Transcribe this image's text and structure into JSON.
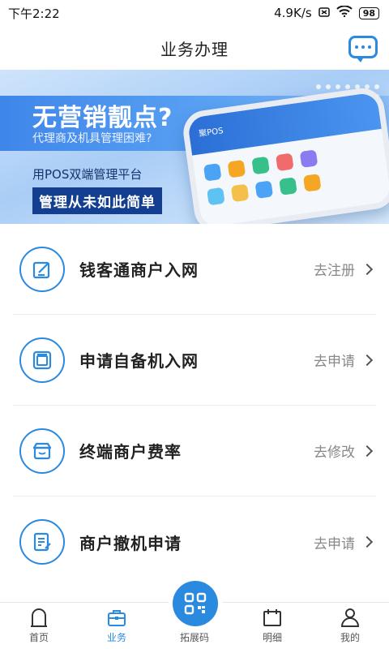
{
  "status_bar": {
    "time": "下午2:22",
    "speed": "4.9K/s",
    "battery": "98"
  },
  "header": {
    "title": "业务办理",
    "message_icon": "chat-bubble-icon"
  },
  "banner": {
    "title": "无营销靓点?",
    "subtitle": "代理商及机具管理困难?",
    "line": "用POS双端管理平台",
    "tag": "管理从未如此简单",
    "phone_brand": "聚POS"
  },
  "services": [
    {
      "label": "钱客通商户入网",
      "action": "去注册",
      "icon": "edit-note-icon"
    },
    {
      "label": "申请自备机入网",
      "action": "去申请",
      "icon": "pos-device-icon"
    },
    {
      "label": "终端商户费率",
      "action": "去修改",
      "icon": "store-icon"
    },
    {
      "label": "商户撤机申请",
      "action": "去申请",
      "icon": "document-edit-icon"
    }
  ],
  "tabbar": {
    "items": [
      {
        "label": "首页",
        "icon": "home-icon"
      },
      {
        "label": "业务",
        "icon": "briefcase-icon",
        "active": true
      },
      {
        "label": "拓展码",
        "icon": "qr-code-icon"
      },
      {
        "label": "明细",
        "icon": "calendar-icon"
      },
      {
        "label": "我的",
        "icon": "user-icon"
      }
    ]
  },
  "colors": {
    "accent": "#2a8ae0",
    "banner_tag": "#143e8f"
  }
}
